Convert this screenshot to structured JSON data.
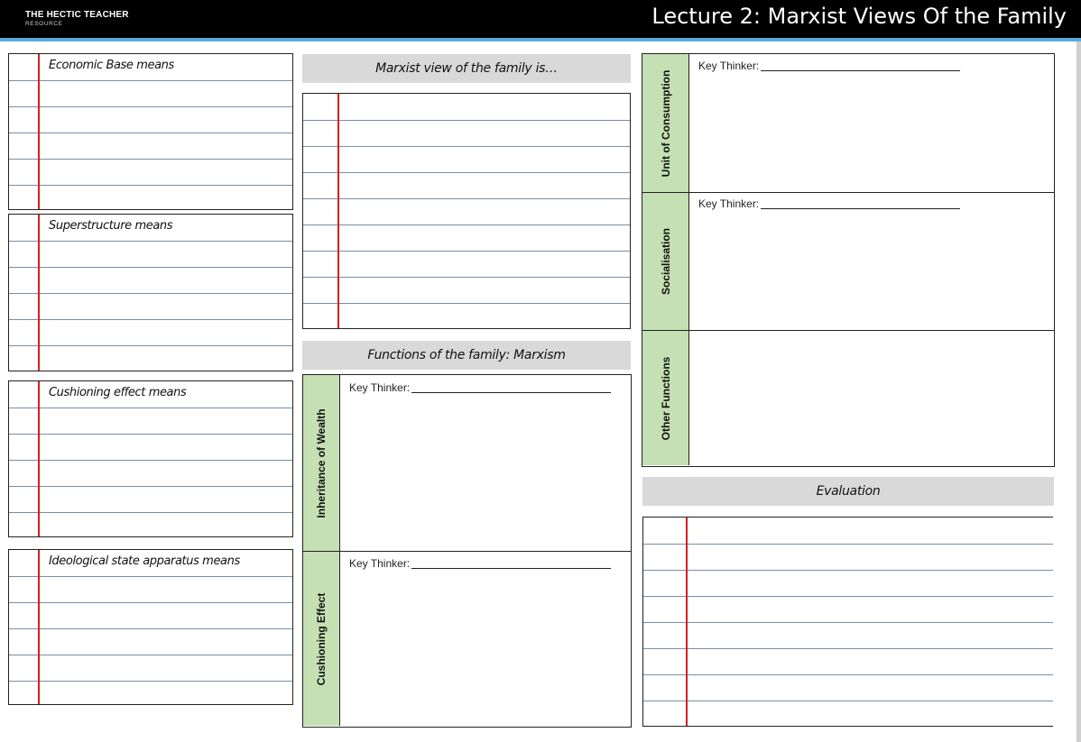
{
  "header": {
    "brand_line1": "THE HECTIC TEACHER",
    "brand_line2": "RESOURCE",
    "title": "Lecture 2: Marxist Views Of the Family"
  },
  "left_boxes": [
    {
      "label": "Economic Base means"
    },
    {
      "label": "Superstructure means"
    },
    {
      "label": "Cushioning effect means"
    },
    {
      "label": "Ideological state apparatus means"
    }
  ],
  "middle": {
    "marxist_view_heading": "Marxist view of the family is…",
    "functions_heading": "Functions of the family: Marxism",
    "functions": [
      {
        "side_label": "Inheritance of Wealth",
        "key_thinker": "Key Thinker:"
      },
      {
        "side_label": "Cushioning Effect",
        "key_thinker": "Key Thinker:"
      }
    ]
  },
  "right": {
    "functions": [
      {
        "side_label": "Unit of Consumption",
        "key_thinker": "Key Thinker:"
      },
      {
        "side_label": "Socialisation",
        "key_thinker": "Key Thinker:"
      },
      {
        "side_label": "Other Functions"
      }
    ],
    "evaluation_heading": "Evaluation"
  },
  "colors": {
    "header_bg": "#000000",
    "header_accent": "#5aa9dd",
    "side_label_green": "#c5e0b3",
    "heading_grey": "#d9d9d9",
    "margin_red": "#d32020",
    "rule_blue": "#7a8ea6"
  }
}
